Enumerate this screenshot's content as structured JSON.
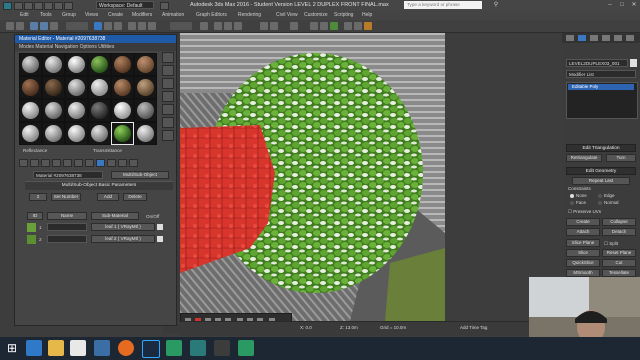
{
  "titlebar": {
    "workspace": "Workspace: Default",
    "title": "Autodesk 3ds Max 2016 - Student Version   LEVEL 2 DUPLEX FRONT FINAL.max",
    "search_placeholder": "Type a keyword or phrase"
  },
  "menu": [
    "Edit",
    "Tools",
    "Group",
    "Views",
    "Create",
    "Modifiers",
    "Animation",
    "Graph Editors",
    "Rendering",
    "Civil View",
    "Customize",
    "Scripting",
    "Help"
  ],
  "material_editor": {
    "title": "Material Editor - Material #2097638738",
    "menu": "Modes   Material   Navigation   Options   Utilities",
    "current_material": "Material #2097638738",
    "material_type": "Multi/Sub-Object",
    "rollout_title": "Multi/Sub-Object Basic Parameters",
    "set_number_label": "Set Number",
    "add_label": "Add",
    "delete_label": "Delete",
    "count": "2",
    "columns": [
      "ID",
      "Name",
      "Sub-Material",
      "On/Off"
    ],
    "rows": [
      {
        "id": "1",
        "sub_material": "leaf 1 ( VRayMtl )"
      },
      {
        "id": "2",
        "sub_material": "leaf 2 ( VRayMtl )"
      }
    ],
    "reflectance": "Reflectance",
    "transmittance": "Transmittance"
  },
  "command_panel": {
    "object_name": "LEVEL2DUPLEX03_001",
    "modifier_list_label": "Modifier List",
    "modifier_stack_item": "Editable Poly",
    "rollouts": {
      "edit_triangulation": "Edit Triangulation",
      "retriangulate": "Retriangulate",
      "turn": "Turn",
      "subdiv": "Subdivision Surface",
      "edit_geometry": "Edit Geometry",
      "repeat_last": "Repeat Last",
      "constraints": "Constraints",
      "none": "None",
      "edge": "Edge",
      "face": "Face",
      "normal": "Normal",
      "preserve_uvs": "Preserve UVs",
      "create": "Create",
      "collapse": "Collapse",
      "attach": "Attach",
      "detach": "Detach",
      "slice_plane": "Slice Plane",
      "split": "Split",
      "slice": "Slice",
      "reset_plane": "Reset Plane",
      "quickslice": "QuickSlice",
      "cut": "Cut",
      "msmooth": "MSmooth",
      "tessellate": "Tessellate",
      "make_planar": "Make Planar"
    }
  },
  "status": {
    "add_time_tag": "Add Time Tag",
    "coord_x": "X: 0.0",
    "coord_z": "Z: 13.0m",
    "grid": "Grid = 10.0m"
  },
  "taskbar": {
    "icons": [
      "windows-start",
      "internet-explorer",
      "file-explorer",
      "media-player",
      "firefox",
      "photoshop",
      "cinema4d",
      "camtasia",
      "3dsmax",
      "camtasia-recorder",
      "other"
    ]
  },
  "colors": {
    "accent": "#2e65b3",
    "foliage": "#4f8f2a",
    "selected_foliage": "#d63a32"
  }
}
